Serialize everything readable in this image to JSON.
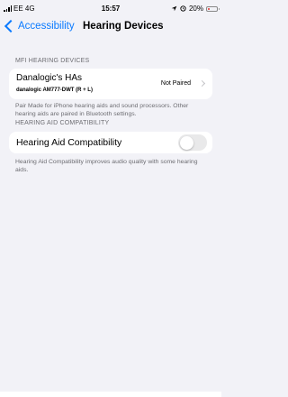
{
  "status_bar": {
    "carrier": "EE 4G",
    "time": "15:57",
    "battery_percent": "20%",
    "battery_level": 0.2,
    "battery_color": "#e0322d",
    "icons": [
      "signal-icon",
      "location-icon",
      "alarm-icon",
      "battery-icon"
    ]
  },
  "nav": {
    "back_label": "Accessibility",
    "title": "Hearing Devices",
    "accent_color": "#0a7aff"
  },
  "mfi": {
    "header": "MFI HEARING DEVICES",
    "device_name": "Danalogic's HAs",
    "device_model": "danalogic AM777-DWT (R + L)",
    "device_status": "Not Paired",
    "footer": "Pair Made for iPhone hearing aids and sound processors. Other hearing aids are paired in Bluetooth settings."
  },
  "hac": {
    "header": "HEARING AID COMPATIBILITY",
    "label": "Hearing Aid Compatibility",
    "enabled": false,
    "footer": "Hearing Aid Compatibility improves audio quality with some hearing aids."
  }
}
